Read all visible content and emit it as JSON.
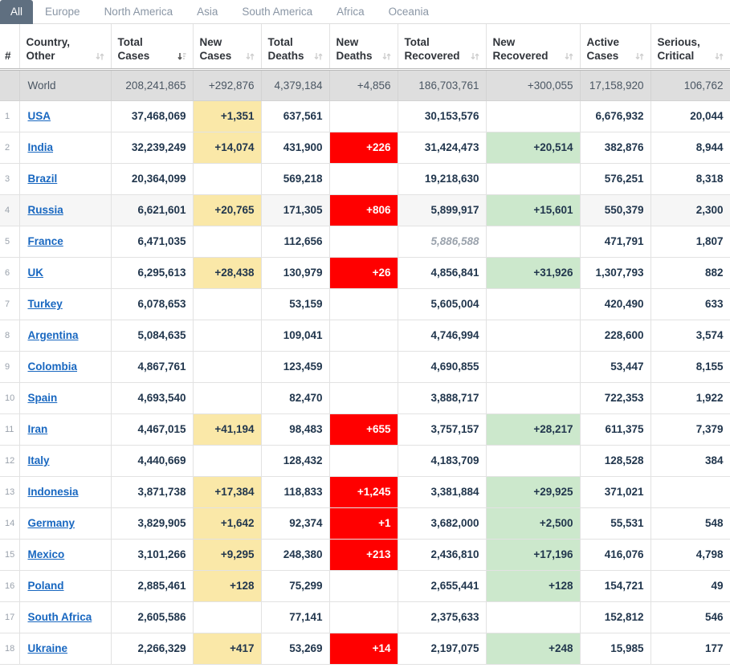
{
  "tabs": [
    {
      "label": "All",
      "active": true
    },
    {
      "label": "Europe",
      "active": false
    },
    {
      "label": "North America",
      "active": false
    },
    {
      "label": "Asia",
      "active": false
    },
    {
      "label": "South America",
      "active": false
    },
    {
      "label": "Africa",
      "active": false
    },
    {
      "label": "Oceania",
      "active": false
    }
  ],
  "columns": [
    {
      "key": "num",
      "label": "#",
      "sort": "none"
    },
    {
      "key": "name",
      "label": "Country,\nOther",
      "sort": "both"
    },
    {
      "key": "tc",
      "label": "Total\nCases",
      "sort": "desc"
    },
    {
      "key": "nc",
      "label": "New\nCases",
      "sort": "both"
    },
    {
      "key": "td",
      "label": "Total\nDeaths",
      "sort": "both"
    },
    {
      "key": "nd",
      "label": "New\nDeaths",
      "sort": "both"
    },
    {
      "key": "tr",
      "label": "Total\nRecovered",
      "sort": "both"
    },
    {
      "key": "nr",
      "label": "New\nRecovered",
      "sort": "both"
    },
    {
      "key": "ac",
      "label": "Active\nCases",
      "sort": "both"
    },
    {
      "key": "sc",
      "label": "Serious,\nCritical",
      "sort": "both"
    }
  ],
  "column_labels": {
    "num": "#",
    "name_l1": "Country,",
    "name_l2": "Other",
    "tc_l1": "Total",
    "tc_l2": "Cases",
    "nc_l1": "New",
    "nc_l2": "Cases",
    "td_l1": "Total",
    "td_l2": "Deaths",
    "nd_l1": "New",
    "nd_l2": "Deaths",
    "tr_l1": "Total",
    "tr_l2": "Recovered",
    "nr_l1": "New",
    "nr_l2": "Recovered",
    "ac_l1": "Active",
    "ac_l2": "Cases",
    "sc_l1": "Serious,",
    "sc_l2": "Critical"
  },
  "world_row": {
    "num": "",
    "name": "World",
    "total_cases": "208,241,865",
    "new_cases": "+292,876",
    "total_deaths": "4,379,184",
    "new_deaths": "+4,856",
    "total_recovered": "186,703,761",
    "new_recovered": "+300,055",
    "active_cases": "17,158,920",
    "serious_critical": "106,762"
  },
  "rows": [
    {
      "num": "1",
      "name": "USA",
      "total_cases": "37,468,069",
      "new_cases": "+1,351",
      "total_deaths": "637,561",
      "new_deaths": "",
      "total_recovered": "30,153,576",
      "new_recovered": "",
      "active_cases": "6,676,932",
      "serious_critical": "20,044",
      "striped": false,
      "recovered_estimate": false
    },
    {
      "num": "2",
      "name": "India",
      "total_cases": "32,239,249",
      "new_cases": "+14,074",
      "total_deaths": "431,900",
      "new_deaths": "+226",
      "total_recovered": "31,424,473",
      "new_recovered": "+20,514",
      "active_cases": "382,876",
      "serious_critical": "8,944",
      "striped": false,
      "recovered_estimate": false
    },
    {
      "num": "3",
      "name": "Brazil",
      "total_cases": "20,364,099",
      "new_cases": "",
      "total_deaths": "569,218",
      "new_deaths": "",
      "total_recovered": "19,218,630",
      "new_recovered": "",
      "active_cases": "576,251",
      "serious_critical": "8,318",
      "striped": false,
      "recovered_estimate": false
    },
    {
      "num": "4",
      "name": "Russia",
      "total_cases": "6,621,601",
      "new_cases": "+20,765",
      "total_deaths": "171,305",
      "new_deaths": "+806",
      "total_recovered": "5,899,917",
      "new_recovered": "+15,601",
      "active_cases": "550,379",
      "serious_critical": "2,300",
      "striped": true,
      "recovered_estimate": false
    },
    {
      "num": "5",
      "name": "France",
      "total_cases": "6,471,035",
      "new_cases": "",
      "total_deaths": "112,656",
      "new_deaths": "",
      "total_recovered": "5,886,588",
      "new_recovered": "",
      "active_cases": "471,791",
      "serious_critical": "1,807",
      "striped": false,
      "recovered_estimate": true
    },
    {
      "num": "6",
      "name": "UK",
      "total_cases": "6,295,613",
      "new_cases": "+28,438",
      "total_deaths": "130,979",
      "new_deaths": "+26",
      "total_recovered": "4,856,841",
      "new_recovered": "+31,926",
      "active_cases": "1,307,793",
      "serious_critical": "882",
      "striped": false,
      "recovered_estimate": false
    },
    {
      "num": "7",
      "name": "Turkey",
      "total_cases": "6,078,653",
      "new_cases": "",
      "total_deaths": "53,159",
      "new_deaths": "",
      "total_recovered": "5,605,004",
      "new_recovered": "",
      "active_cases": "420,490",
      "serious_critical": "633",
      "striped": false,
      "recovered_estimate": false
    },
    {
      "num": "8",
      "name": "Argentina",
      "total_cases": "5,084,635",
      "new_cases": "",
      "total_deaths": "109,041",
      "new_deaths": "",
      "total_recovered": "4,746,994",
      "new_recovered": "",
      "active_cases": "228,600",
      "serious_critical": "3,574",
      "striped": false,
      "recovered_estimate": false
    },
    {
      "num": "9",
      "name": "Colombia",
      "total_cases": "4,867,761",
      "new_cases": "",
      "total_deaths": "123,459",
      "new_deaths": "",
      "total_recovered": "4,690,855",
      "new_recovered": "",
      "active_cases": "53,447",
      "serious_critical": "8,155",
      "striped": false,
      "recovered_estimate": false
    },
    {
      "num": "10",
      "name": "Spain",
      "total_cases": "4,693,540",
      "new_cases": "",
      "total_deaths": "82,470",
      "new_deaths": "",
      "total_recovered": "3,888,717",
      "new_recovered": "",
      "active_cases": "722,353",
      "serious_critical": "1,922",
      "striped": false,
      "recovered_estimate": false
    },
    {
      "num": "11",
      "name": "Iran",
      "total_cases": "4,467,015",
      "new_cases": "+41,194",
      "total_deaths": "98,483",
      "new_deaths": "+655",
      "total_recovered": "3,757,157",
      "new_recovered": "+28,217",
      "active_cases": "611,375",
      "serious_critical": "7,379",
      "striped": false,
      "recovered_estimate": false
    },
    {
      "num": "12",
      "name": "Italy",
      "total_cases": "4,440,669",
      "new_cases": "",
      "total_deaths": "128,432",
      "new_deaths": "",
      "total_recovered": "4,183,709",
      "new_recovered": "",
      "active_cases": "128,528",
      "serious_critical": "384",
      "striped": false,
      "recovered_estimate": false
    },
    {
      "num": "13",
      "name": "Indonesia",
      "total_cases": "3,871,738",
      "new_cases": "+17,384",
      "total_deaths": "118,833",
      "new_deaths": "+1,245",
      "total_recovered": "3,381,884",
      "new_recovered": "+29,925",
      "active_cases": "371,021",
      "serious_critical": "",
      "striped": false,
      "recovered_estimate": false
    },
    {
      "num": "14",
      "name": "Germany",
      "total_cases": "3,829,905",
      "new_cases": "+1,642",
      "total_deaths": "92,374",
      "new_deaths": "+1",
      "total_recovered": "3,682,000",
      "new_recovered": "+2,500",
      "active_cases": "55,531",
      "serious_critical": "548",
      "striped": false,
      "recovered_estimate": false
    },
    {
      "num": "15",
      "name": "Mexico",
      "total_cases": "3,101,266",
      "new_cases": "+9,295",
      "total_deaths": "248,380",
      "new_deaths": "+213",
      "total_recovered": "2,436,810",
      "new_recovered": "+17,196",
      "active_cases": "416,076",
      "serious_critical": "4,798",
      "striped": false,
      "recovered_estimate": false
    },
    {
      "num": "16",
      "name": "Poland",
      "total_cases": "2,885,461",
      "new_cases": "+128",
      "total_deaths": "75,299",
      "new_deaths": "",
      "total_recovered": "2,655,441",
      "new_recovered": "+128",
      "active_cases": "154,721",
      "serious_critical": "49",
      "striped": false,
      "recovered_estimate": false
    },
    {
      "num": "17",
      "name": "South Africa",
      "total_cases": "2,605,586",
      "new_cases": "",
      "total_deaths": "77,141",
      "new_deaths": "",
      "total_recovered": "2,375,633",
      "new_recovered": "",
      "active_cases": "152,812",
      "serious_critical": "546",
      "striped": false,
      "recovered_estimate": false
    },
    {
      "num": "18",
      "name": "Ukraine",
      "total_cases": "2,266,329",
      "new_cases": "+417",
      "total_deaths": "53,269",
      "new_deaths": "+14",
      "total_recovered": "2,197,075",
      "new_recovered": "+248",
      "active_cases": "15,985",
      "serious_critical": "177",
      "striped": false,
      "recovered_estimate": false
    }
  ],
  "colors": {
    "active_tab_bg": "#5f6f80",
    "tab_text": "#8a96a5",
    "new_cases_highlight": "#fae8a8",
    "new_deaths_highlight": "#ff0000",
    "new_recovered_highlight": "#cce8cc",
    "world_row_bg": "#dedede",
    "link": "#1867c0",
    "text": "#21364d"
  }
}
